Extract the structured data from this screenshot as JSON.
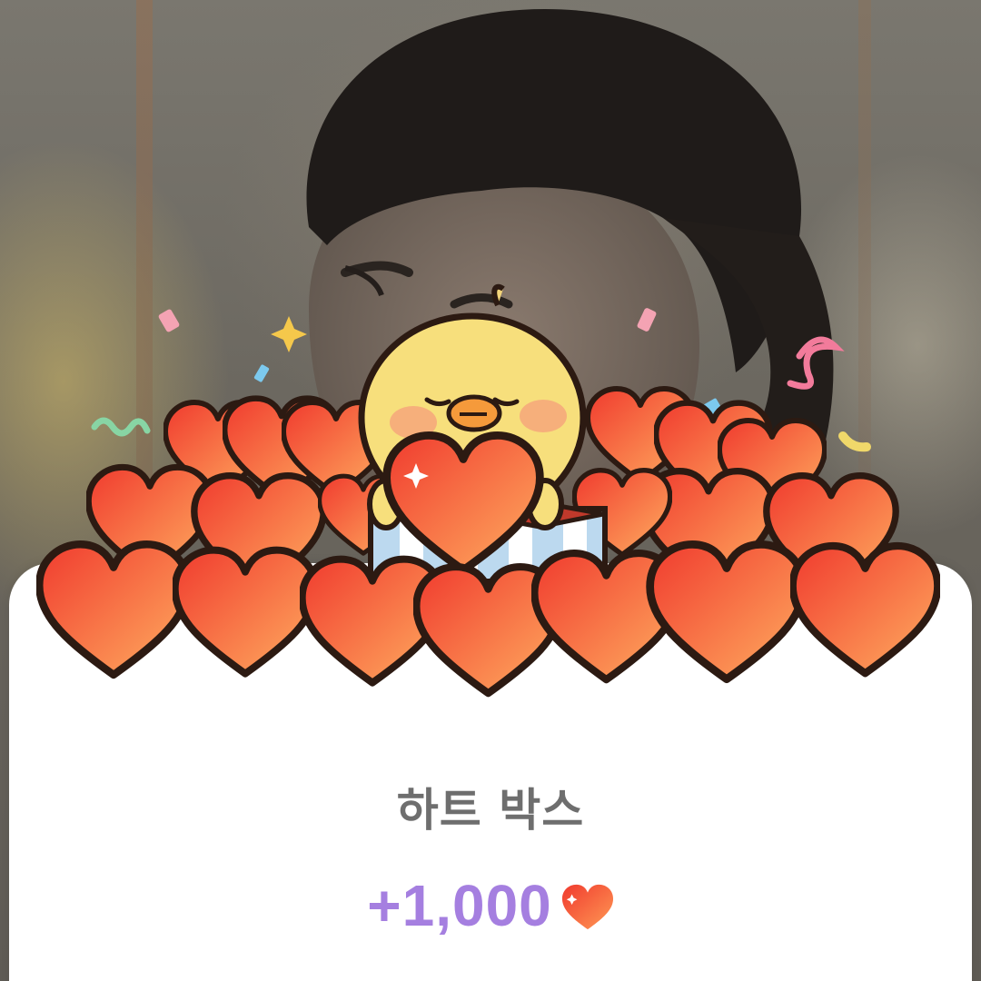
{
  "reward": {
    "title": "하트 박스",
    "amount": "+1,000",
    "currency_icon": "heart-icon"
  },
  "colors": {
    "heart": "#f35a3c",
    "heart_highlight": "#ff9a55",
    "amount_text": "#a57fe0",
    "title_text": "#6e6e6e",
    "card_background": "#ffffff"
  },
  "background": {
    "subject": "person-photo"
  },
  "illustration": {
    "subject": "chick-holding-heart-in-heart-box"
  }
}
